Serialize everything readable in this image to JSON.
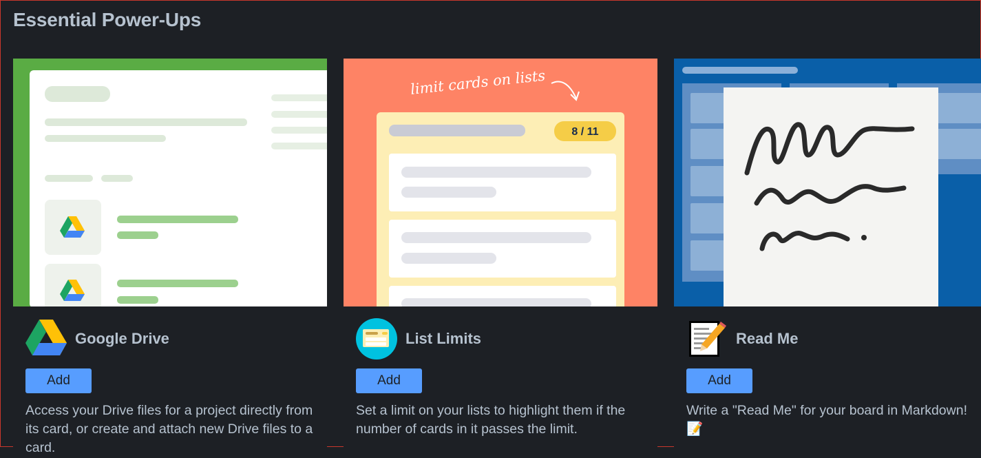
{
  "page": {
    "title": "Essential Power-Ups"
  },
  "powerups": [
    {
      "name": "Google Drive",
      "add_label": "Add",
      "description": "Access your Drive files for a project directly from its card, or create and attach new Drive files to a card.",
      "logo_icon": "google-drive-icon",
      "hero_color": "#5aac44"
    },
    {
      "name": "List Limits",
      "add_label": "Add",
      "description": "Set a limit on your lists to highlight them if the number of cards in it passes the limit.",
      "logo_icon": "list-limits-icon",
      "hero_color": "#fe8365",
      "hero_caption": "limit cards on lists",
      "hero_badge": "8 / 11"
    },
    {
      "name": "Read Me",
      "add_label": "Add",
      "description": "Write a \"Read Me\" for your board in Markdown! 📝",
      "logo_icon": "memo-icon",
      "hero_color": "#0a5fa8"
    }
  ]
}
